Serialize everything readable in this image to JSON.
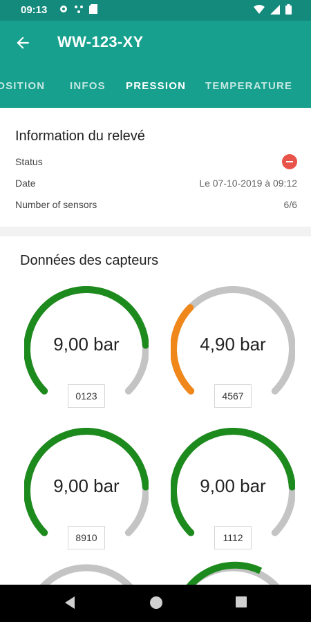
{
  "status_bar": {
    "time": "09:13"
  },
  "app_bar": {
    "title": "WW-123-XY",
    "tabs": [
      {
        "label": "POSITION"
      },
      {
        "label": "INFOS"
      },
      {
        "label": "PRESSION",
        "active": true
      },
      {
        "label": "TEMPERATURE"
      }
    ]
  },
  "info_card": {
    "heading": "Information du relevé",
    "rows": {
      "status": {
        "label": "Status",
        "icon": "error-icon",
        "color": "#e8534a"
      },
      "date": {
        "label": "Date",
        "value": "Le 07-10-2019 à 09:12"
      },
      "sensors": {
        "label": "Number of sensors",
        "value": "6/6"
      }
    }
  },
  "sensors_section": {
    "heading": "Données des capteurs",
    "gauges": [
      {
        "value": "9,00 bar",
        "id": "0123",
        "fraction": 0.82,
        "color": "#1d8a1d"
      },
      {
        "value": "4,90 bar",
        "id": "4567",
        "fraction": 0.33,
        "color": "#f0871a"
      },
      {
        "value": "9,00 bar",
        "id": "8910",
        "fraction": 0.82,
        "color": "#1d8a1d"
      },
      {
        "value": "9,00 bar",
        "id": "1112",
        "fraction": 0.82,
        "color": "#1d8a1d"
      }
    ]
  },
  "colors": {
    "status_bar": "#138a7c",
    "app_bar": "#16a08d",
    "gauge_track": "#c4c4c4"
  }
}
